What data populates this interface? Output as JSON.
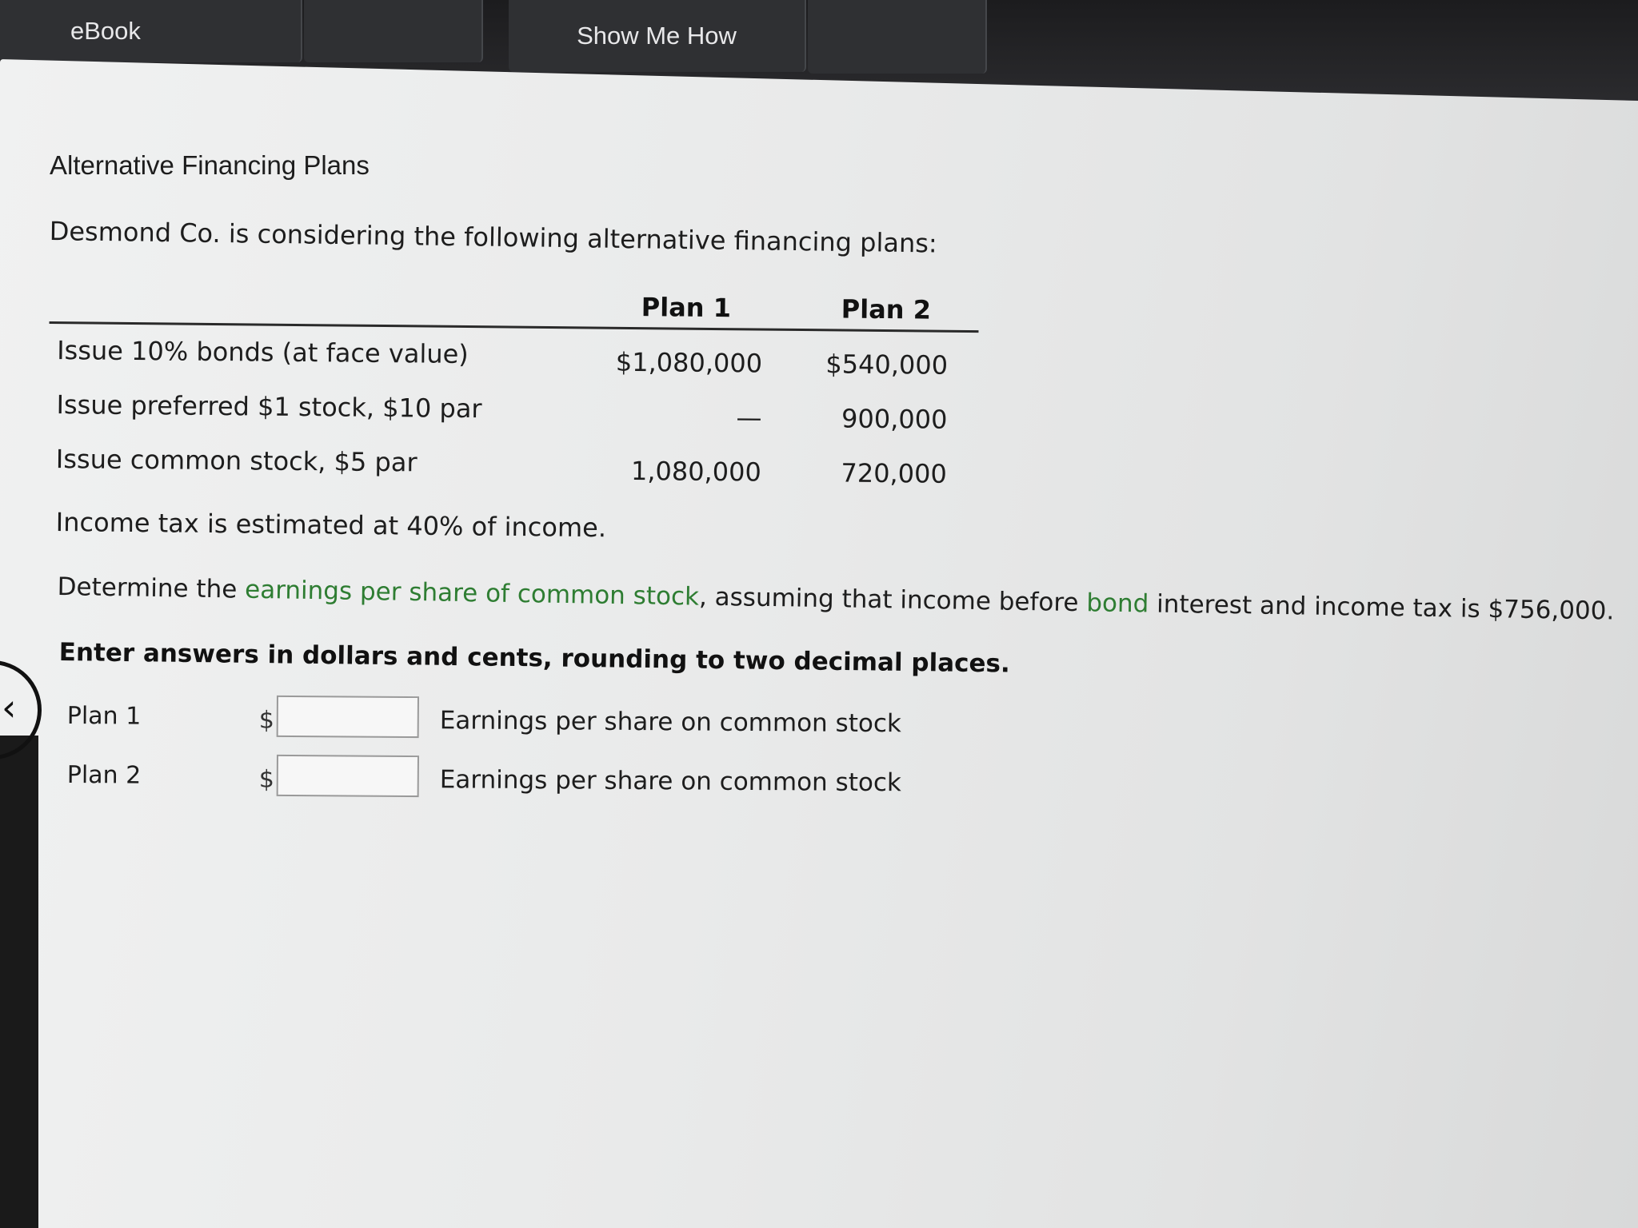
{
  "tabs": {
    "ebook": "eBook",
    "show_me_how": "Show Me How"
  },
  "page": {
    "title": "Alternative Financing Plans",
    "intro": "Desmond Co. is considering the following alternative financing plans:"
  },
  "table": {
    "col_plan1": "Plan 1",
    "col_plan2": "Plan 2",
    "rows": [
      {
        "label": "Issue 10% bonds (at face value)",
        "plan1": "$1,080,000",
        "plan2": "$540,000"
      },
      {
        "label": "Issue preferred $1 stock, $10 par",
        "plan1": "—",
        "plan2": "900,000"
      },
      {
        "label": "Issue common stock, $5 par",
        "plan1": "1,080,000",
        "plan2": "720,000"
      }
    ]
  },
  "tax_note": "Income tax is estimated at 40% of income.",
  "question": {
    "part1": "Determine the ",
    "term1": "earnings per share of common stock",
    "part2": ", assuming that income before ",
    "term2": "bond",
    "part3": " interest and income tax is $756,000."
  },
  "instruction": "Enter answers in dollars and cents, rounding to two decimal places.",
  "answers": [
    {
      "label": "Plan 1",
      "currency": "$",
      "value": "",
      "description": "Earnings per share on common stock"
    },
    {
      "label": "Plan 2",
      "currency": "$",
      "value": "",
      "description": "Earnings per share on common stock"
    }
  ],
  "colors": {
    "term_link": "#2e7d32",
    "topbar": "#1c1c1e"
  },
  "icons": {
    "back": "chevron-left-icon"
  }
}
